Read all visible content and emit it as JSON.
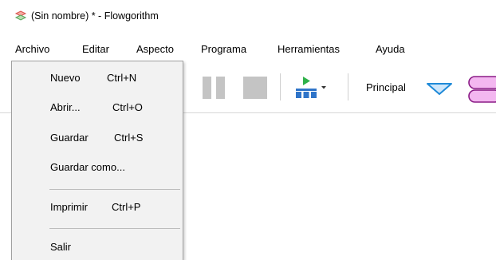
{
  "window": {
    "title": "(Sin nombre) * - Flowgorithm",
    "app_icon": "flowgorithm-app-icon"
  },
  "menubar": {
    "items": [
      {
        "label": "Archivo"
      },
      {
        "label": "Editar"
      },
      {
        "label": "Aspecto"
      },
      {
        "label": "Programa"
      },
      {
        "label": "Herramientas"
      },
      {
        "label": "Ayuda"
      }
    ]
  },
  "toolbar": {
    "buttons": [
      {
        "icon": "pause-icon"
      },
      {
        "icon": "stop-icon"
      },
      {
        "icon": "run-icon"
      }
    ],
    "function_selector": {
      "value": "Principal",
      "icon": "triangle-down-icon"
    },
    "shape_icon": "terminal-shape-icon",
    "colors": {
      "disabled": "#c4c4c4",
      "run_green": "#2fb14a",
      "blocks_blue": "#2f74c9",
      "arrow_blue": "#1f8ad8",
      "shape_pink": "#f3b7f0"
    }
  },
  "file_menu": {
    "items": [
      {
        "label": "Nuevo",
        "shortcut": "Ctrl+N"
      },
      {
        "label": "Abrir...",
        "shortcut": "Ctrl+O"
      },
      {
        "label": "Guardar",
        "shortcut": "Ctrl+S"
      },
      {
        "label": "Guardar como...",
        "shortcut": ""
      },
      {
        "label": "Imprimir",
        "shortcut": "Ctrl+P"
      },
      {
        "label": "Salir",
        "shortcut": ""
      }
    ]
  }
}
